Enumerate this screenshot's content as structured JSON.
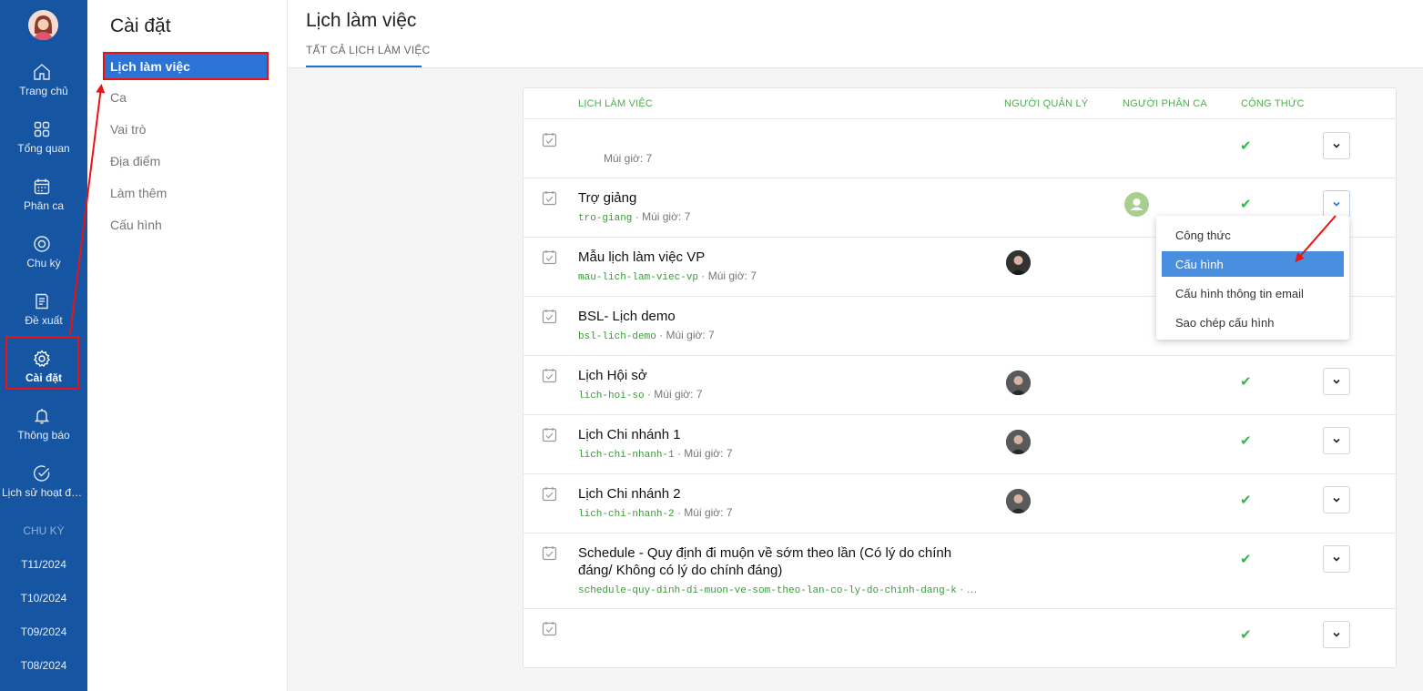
{
  "nav": {
    "items": [
      {
        "label": "Trang chủ",
        "icon": "home-icon"
      },
      {
        "label": "Tổng quan",
        "icon": "grid-icon"
      },
      {
        "label": "Phân ca",
        "icon": "calendar-icon"
      },
      {
        "label": "Chu kỳ",
        "icon": "cycle-icon"
      },
      {
        "label": "Đề xuất",
        "icon": "proposal-icon"
      },
      {
        "label": "Cài đặt",
        "icon": "gear-icon"
      },
      {
        "label": "Thông báo",
        "icon": "bell-icon"
      },
      {
        "label": "Lịch sử hoạt động",
        "icon": "check-circle-icon"
      }
    ],
    "cycle_heading": "CHU KỲ",
    "cycles": [
      "T11/2024",
      "T10/2024",
      "T09/2024",
      "T08/2024"
    ]
  },
  "settings": {
    "title": "Cài đặt",
    "active_item": "Lịch làm việc",
    "items": [
      "Ca",
      "Vai trò",
      "Địa điểm",
      "Làm thêm",
      "Cấu hình"
    ]
  },
  "main": {
    "title": "Lịch làm việc",
    "tab": "TẤT CẢ LỊCH LÀM VIỆC"
  },
  "table": {
    "headers": {
      "schedule": "LỊCH LÀM VIỆC",
      "manager": "NGƯỜI QUẢN LÝ",
      "assigner": "NGƯỜI PHÂN CA",
      "formula": "CÔNG THỨC"
    },
    "rows": [
      {
        "name": "",
        "slug": "",
        "tz": "Múi giờ: 7",
        "formula_check": "✔"
      },
      {
        "name": "Trợ giảng",
        "slug": "tro-giang",
        "tz": " · Múi giờ: 7",
        "formula_check": "✔"
      },
      {
        "name": "Mẫu lịch làm việc VP",
        "slug": "mau-lich-lam-viec-vp",
        "tz": " · Múi giờ: 7",
        "formula_check": ""
      },
      {
        "name": "BSL- Lịch demo",
        "slug": "bsl-lich-demo",
        "tz": " · Múi giờ: 7",
        "formula_check": ""
      },
      {
        "name": "Lịch Hội sở",
        "slug": "lich-hoi-so",
        "tz": " · Múi giờ: 7",
        "formula_check": "✔"
      },
      {
        "name": "Lịch Chi nhánh 1",
        "slug": "lich-chi-nhanh-1",
        "tz": " · Múi giờ: 7",
        "formula_check": "✔"
      },
      {
        "name": "Lịch Chi nhánh 2",
        "slug": "lich-chi-nhanh-2",
        "tz": " · Múi giờ: 7",
        "formula_check": "✔"
      },
      {
        "name": "Schedule - Quy định đi muộn về sớm theo lần (Có lý do chính đáng/ Không có lý do chính đáng)",
        "slug": "schedule-quy-dinh-di-muon-ve-som-theo-lan-co-ly-do-chinh-dang-k",
        "tz": " · …",
        "formula_check": "✔"
      },
      {
        "name": "",
        "slug": "",
        "tz": "",
        "formula_check": "✔"
      }
    ]
  },
  "dropdown_menu": {
    "items": [
      "Công thức",
      "Cấu hình",
      "Cấu hình thông tin email",
      "Sao chép cấu hình"
    ],
    "selected": "Cấu hình"
  },
  "colors": {
    "nav_bg": "#1655a2",
    "accent": "#2b73d6",
    "header_green": "#4cae4c",
    "annotation_red": "#e11111"
  }
}
